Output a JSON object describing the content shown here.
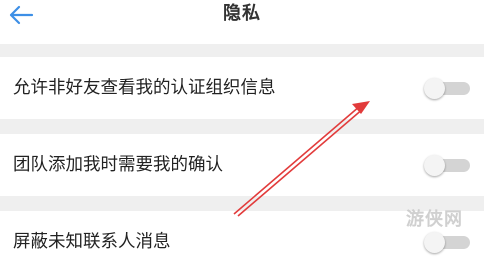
{
  "header": {
    "title": "隐私",
    "back_icon": "arrow-left-icon",
    "accent_color": "#3d8fe6"
  },
  "settings": [
    {
      "label": "允许非好友查看我的认证组织信息",
      "enabled": false
    },
    {
      "label": "团队添加我时需要我的确认",
      "enabled": false
    },
    {
      "label": "屏蔽未知联系人消息",
      "enabled": false
    }
  ],
  "annotation": {
    "arrow_color": "#e23b3b"
  },
  "watermark": {
    "text": "游侠网"
  }
}
